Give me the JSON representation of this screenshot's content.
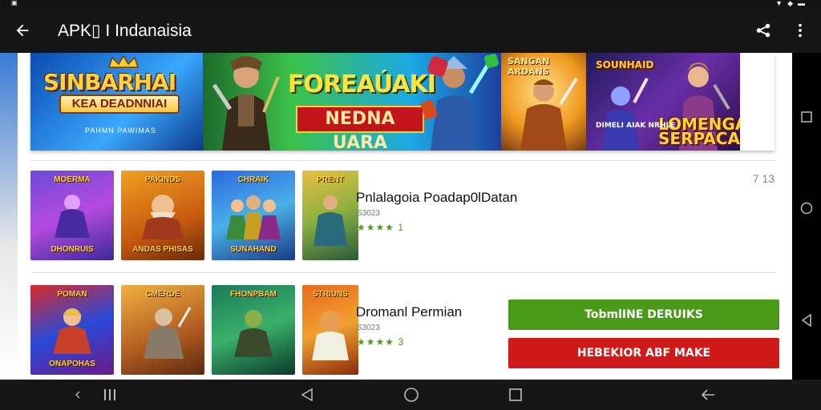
{
  "status": {
    "left_icon": "notification-icon",
    "right_icons": [
      "signal-icon",
      "wifi-icon",
      "battery-icon"
    ]
  },
  "appbar": {
    "title": "APK▯ I Indanaisia",
    "back_icon": "arrow-back-icon",
    "actions": [
      "share-icon",
      "more-vert-icon"
    ]
  },
  "banner": {
    "panel1": {
      "title": "SINBARHAI",
      "subtitle": "KEA DEADNNIAI",
      "caption": "PAHMN PAWIMAS"
    },
    "panel2": {
      "title": "FOREAÚAKI",
      "subtitle": "NEDNA UARA"
    },
    "panel3": {
      "title": "SANGAN ARDANS"
    },
    "panel4": {
      "title": "SOUNHAID",
      "side_title": "LOMENGAS SERPACAE",
      "caption": "DIMELI AIAK NRHLE"
    }
  },
  "rows": [
    {
      "thumbnails": [
        {
          "top": "MOERMA",
          "bottom": "DHONRUIS"
        },
        {
          "top": "PAKINDS",
          "bottom": "ANDAS PHISAS"
        },
        {
          "top": "CHRAIK",
          "bottom": "SUNAHAND"
        },
        {
          "top": "PRENT",
          "bottom": ""
        }
      ],
      "name": "Pnlalagoia Poadap0lDatan",
      "sub": "S3023",
      "rating": "★★★★ 1",
      "count": "7 13"
    },
    {
      "thumbnails": [
        {
          "top": "POMAN",
          "bottom": "ONAPOHAS"
        },
        {
          "top": "CMERDE",
          "bottom": ""
        },
        {
          "top": "FHONPBAM",
          "bottom": ""
        },
        {
          "top": "STRIUNS",
          "bottom": ""
        }
      ],
      "name": "Dromanl Permian",
      "sub": "S3023",
      "rating": "★★★★ 3",
      "primary_button": "TobmlINE DERUIKS",
      "secondary_button": "HEBEKIOR ABF MAKE"
    }
  ],
  "nav_right": [
    "square-icon",
    "circle-icon",
    "triangle-back-icon"
  ],
  "navbar": [
    "chevron-left-icon",
    "recents-lines-icon",
    "back-triangle-icon",
    "home-circle-icon",
    "overview-square-icon",
    "arrow-left-icon"
  ],
  "colors": {
    "accent_green": "#4a9a1a",
    "accent_red": "#d2191a",
    "star_color": "#4f9a20"
  }
}
